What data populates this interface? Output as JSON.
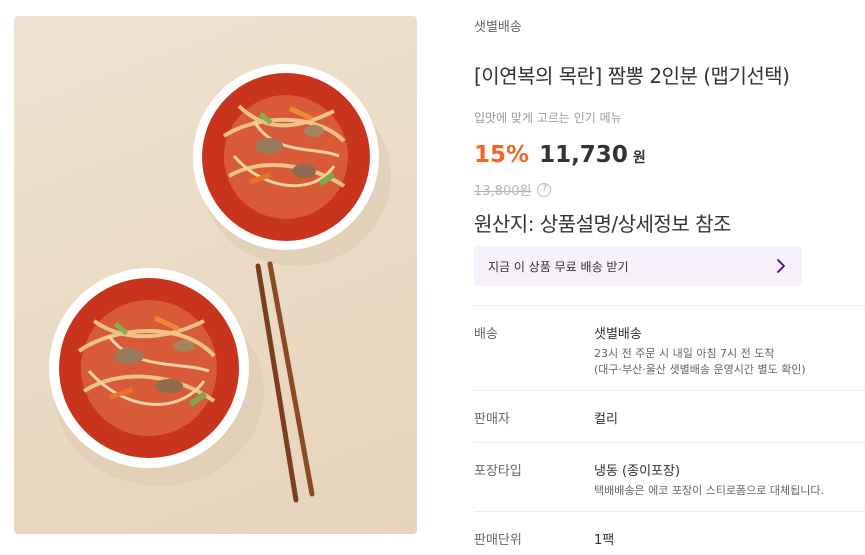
{
  "product": {
    "delivery_type": "샛별배송",
    "title": "[이연복의 목란] 짬뽕 2인분 (맵기선택)",
    "subtitle": "입맛에 맞게 고르는 인기 메뉴",
    "discount": "15%",
    "price": "11,730",
    "currency": "원",
    "original_price": "13,800원",
    "help_symbol": "?",
    "origin": "원산지: 상품설명/상세정보 참조"
  },
  "coupon": {
    "label": "지금 이 상품 무료 배송 받기"
  },
  "details": [
    {
      "label": "배송",
      "value": "샛별배송",
      "notes": [
        "23시 전 주문 시 내일 아침 7시 전 도착",
        "(대구·부산·울산 샛별배송 운영시간 별도 확인)"
      ]
    },
    {
      "label": "판매자",
      "value": "컬리",
      "notes": []
    },
    {
      "label": "포장타입",
      "value": "냉동 (종이포장)",
      "notes": [
        "택배배송은 에코 포장이 스티로폼으로 대체됩니다."
      ]
    },
    {
      "label": "판매단위",
      "value": "1팩",
      "notes": []
    }
  ],
  "colors": {
    "accent_discount": "#f26522",
    "coupon_bg": "#f6f1fa",
    "coupon_arrow": "#5f0080"
  },
  "icons": [
    "help-icon",
    "chevron-right-icon"
  ]
}
